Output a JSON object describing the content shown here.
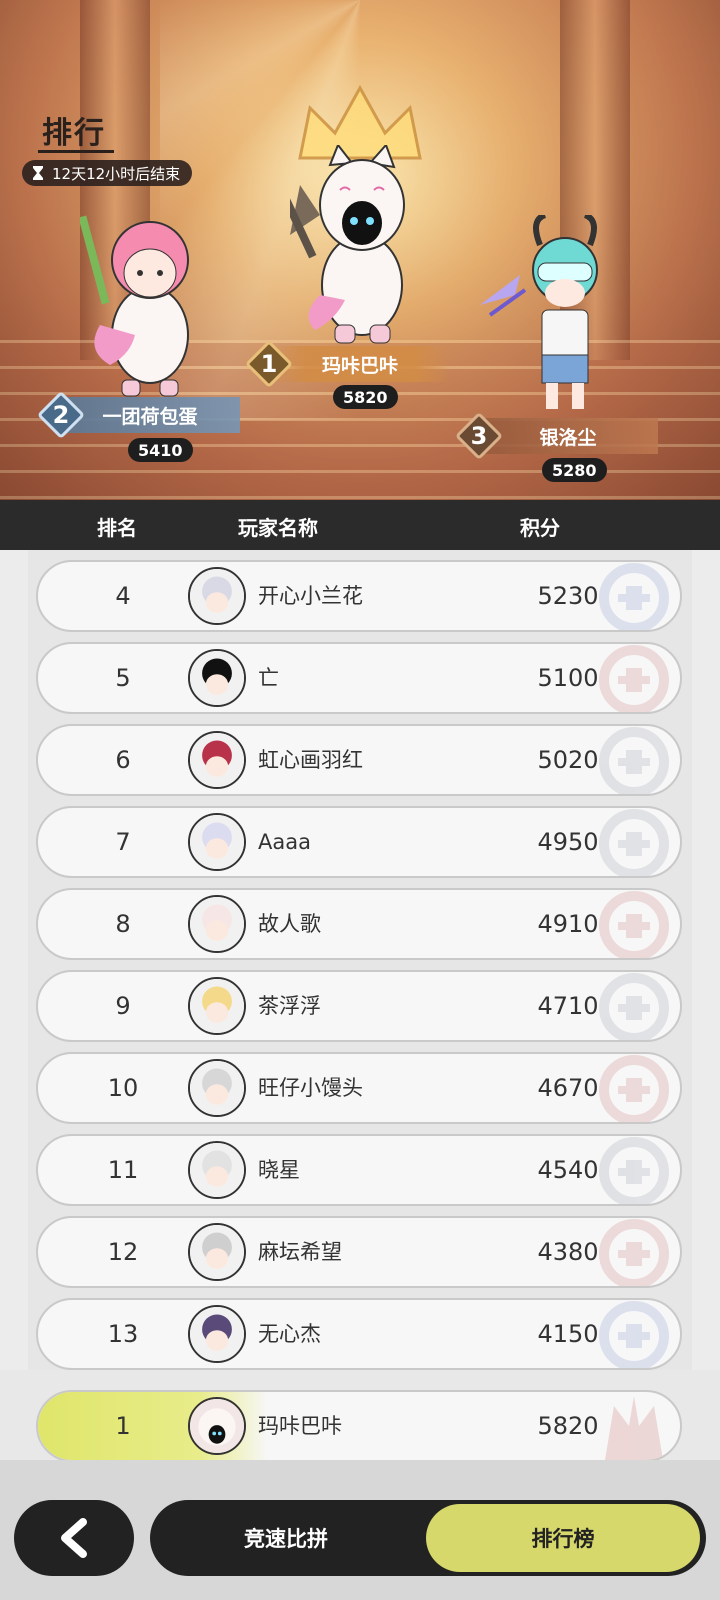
{
  "hero": {
    "title": "排行",
    "timer": "12天12小时后结束",
    "podium": [
      {
        "rank": "1",
        "name": "玛咔巴咔",
        "score": "5820"
      },
      {
        "rank": "2",
        "name": "一团荷包蛋",
        "score": "5410"
      },
      {
        "rank": "3",
        "name": "银洛尘",
        "score": "5280"
      }
    ]
  },
  "header": {
    "rank": "排名",
    "player": "玩家名称",
    "score": "积分"
  },
  "rows": [
    {
      "rank": "4",
      "name": "开心小兰花",
      "score": "5230"
    },
    {
      "rank": "5",
      "name": "亡",
      "score": "5100"
    },
    {
      "rank": "6",
      "name": "虹心画羽红",
      "score": "5020"
    },
    {
      "rank": "7",
      "name": "Aaaa",
      "score": "4950"
    },
    {
      "rank": "8",
      "name": "故人歌",
      "score": "4910"
    },
    {
      "rank": "9",
      "name": "茶浮浮",
      "score": "4710"
    },
    {
      "rank": "10",
      "name": "旺仔小馒头",
      "score": "4670"
    },
    {
      "rank": "11",
      "name": "晓星",
      "score": "4540"
    },
    {
      "rank": "12",
      "name": "麻坛希望",
      "score": "4380"
    },
    {
      "rank": "13",
      "name": "无心杰",
      "score": "4150"
    }
  ],
  "my_row": {
    "rank": "1",
    "name": "玛咔巴咔",
    "score": "5820"
  },
  "tabs": {
    "race": "竞速比拼",
    "leaderboard": "排行榜"
  },
  "colors": {
    "accent": "#d6d86b",
    "dark": "#222222",
    "header": "#2b2b2b"
  }
}
